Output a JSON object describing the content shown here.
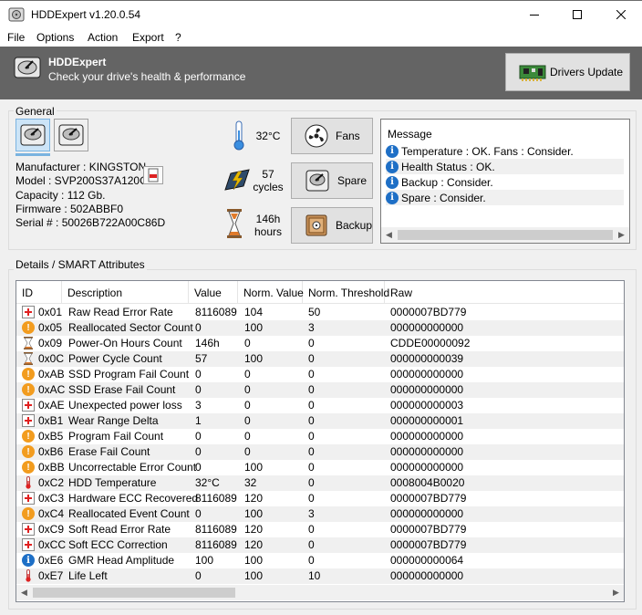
{
  "window": {
    "title": "HDDExpert v1.20.0.54"
  },
  "menu": [
    "File",
    "Options",
    "Action",
    "Export",
    "?"
  ],
  "banner": {
    "title": "HDDExpert",
    "subtitle": "Check your drive's health & performance",
    "drivers_update_label": "Drivers Update"
  },
  "general": {
    "legend": "General",
    "info": [
      "Manufacturer : KINGSTON",
      "Model : SVP200S37A120G",
      "Capacity : 112 Gb.",
      "Firmware : 502ABBF0",
      "Serial # : 50026B722A00C86D"
    ],
    "temperature": "32°C",
    "cycles_value": "57",
    "cycles_unit": "cycles",
    "hours_value": "146h",
    "hours_unit": "hours",
    "buttons": {
      "fans": "Fans",
      "spare": "Spare",
      "backup": "Backup"
    }
  },
  "message": {
    "header": "Message",
    "items": [
      "Temperature : OK. Fans : Consider.",
      "Health Status : OK.",
      "Backup : Consider.",
      "Spare : Consider."
    ]
  },
  "details": {
    "legend": "Details / SMART Attributes",
    "columns": [
      "ID",
      "Description",
      "Value",
      "Norm. Value",
      "Norm. Threshold",
      "Raw"
    ],
    "rows": [
      {
        "icon": "cross",
        "id": "0x01",
        "description": "Raw Read Error Rate",
        "value": "8116089",
        "norm": "104",
        "threshold": "50",
        "raw": "0000007BD779"
      },
      {
        "icon": "warning",
        "id": "0x05",
        "description": "Reallocated Sector Count",
        "value": "0",
        "norm": "100",
        "threshold": "3",
        "raw": "000000000000"
      },
      {
        "icon": "hourglass",
        "id": "0x09",
        "description": "Power-On Hours Count",
        "value": "146h",
        "norm": "0",
        "threshold": "0",
        "raw": "CDDE00000092"
      },
      {
        "icon": "hourglass",
        "id": "0x0C",
        "description": "Power Cycle Count",
        "value": "57",
        "norm": "100",
        "threshold": "0",
        "raw": "000000000039"
      },
      {
        "icon": "warning",
        "id": "0xAB",
        "description": "SSD Program Fail Count",
        "value": "0",
        "norm": "0",
        "threshold": "0",
        "raw": "000000000000"
      },
      {
        "icon": "warning",
        "id": "0xAC",
        "description": "SSD Erase Fail Count",
        "value": "0",
        "norm": "0",
        "threshold": "0",
        "raw": "000000000000"
      },
      {
        "icon": "cross",
        "id": "0xAE",
        "description": "Unexpected power loss",
        "value": "3",
        "norm": "0",
        "threshold": "0",
        "raw": "000000000003"
      },
      {
        "icon": "cross",
        "id": "0xB1",
        "description": "Wear Range Delta",
        "value": "1",
        "norm": "0",
        "threshold": "0",
        "raw": "000000000001"
      },
      {
        "icon": "warning",
        "id": "0xB5",
        "description": "Program Fail Count",
        "value": "0",
        "norm": "0",
        "threshold": "0",
        "raw": "000000000000"
      },
      {
        "icon": "warning",
        "id": "0xB6",
        "description": "Erase Fail Count",
        "value": "0",
        "norm": "0",
        "threshold": "0",
        "raw": "000000000000"
      },
      {
        "icon": "warning",
        "id": "0xBB",
        "description": "Uncorrectable Error Count",
        "value": "0",
        "norm": "100",
        "threshold": "0",
        "raw": "000000000000"
      },
      {
        "icon": "thermometer",
        "id": "0xC2",
        "description": "HDD Temperature",
        "value": "32°C",
        "norm": "32",
        "threshold": "0",
        "raw": "0008004B0020"
      },
      {
        "icon": "cross",
        "id": "0xC3",
        "description": "Hardware ECC Recovered",
        "value": "8116089",
        "norm": "120",
        "threshold": "0",
        "raw": "0000007BD779"
      },
      {
        "icon": "warning",
        "id": "0xC4",
        "description": "Reallocated Event Count",
        "value": "0",
        "norm": "100",
        "threshold": "3",
        "raw": "000000000000"
      },
      {
        "icon": "cross",
        "id": "0xC9",
        "description": "Soft Read Error Rate",
        "value": "8116089",
        "norm": "120",
        "threshold": "0",
        "raw": "0000007BD779"
      },
      {
        "icon": "cross",
        "id": "0xCC",
        "description": "Soft ECC Correction",
        "value": "8116089",
        "norm": "120",
        "threshold": "0",
        "raw": "0000007BD779"
      },
      {
        "icon": "info",
        "id": "0xE6",
        "description": "GMR Head Amplitude",
        "value": "100",
        "norm": "100",
        "threshold": "0",
        "raw": "000000000064"
      },
      {
        "icon": "thermometer",
        "id": "0xE7",
        "description": "Life Left",
        "value": "0",
        "norm": "100",
        "threshold": "10",
        "raw": "000000000000"
      }
    ]
  }
}
